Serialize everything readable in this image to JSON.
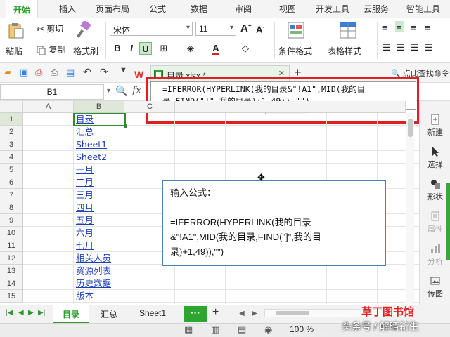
{
  "ribbon_tabs": [
    "开始",
    "插入",
    "页面布局",
    "公式",
    "数据",
    "审阅",
    "视图",
    "开发工具",
    "云服务",
    "智能工具"
  ],
  "ribbon": {
    "paste": "粘贴",
    "cut": "剪切",
    "copy": "复制",
    "format_painter": "格式刷",
    "font_name": "宋体",
    "font_size": "11",
    "bold": "B",
    "italic": "I",
    "underline": "U",
    "conditional_format": "条件格式",
    "table_style": "表格样式"
  },
  "document_tab": {
    "filename": "目录.xlsx *",
    "find_command": "点此查找命令"
  },
  "formula_bar": {
    "name_box": "B1",
    "fx": "fx",
    "formula_line1": "=IFERROR(HYPERLINK(我的目录&\"!A1\",MID(我的目",
    "formula_line2": "录,FIND(\"]\",我的目录)+1,49)),\"\")"
  },
  "columns": [
    "A",
    "B",
    "C"
  ],
  "rows": [
    "1",
    "2",
    "3",
    "4",
    "5",
    "6",
    "7",
    "8",
    "9",
    "10",
    "11",
    "12",
    "13",
    "14",
    "15"
  ],
  "column_b_links": [
    "目录",
    "汇总",
    "Sheet1",
    "Sheet2",
    "一月",
    "二月",
    "三月",
    "四月",
    "五月",
    "六月",
    "七月",
    "相关人员",
    "资源列表",
    "历史数据",
    "版本"
  ],
  "note": {
    "title": "输入公式：",
    "line1": "=IFERROR(HYPERLINK(我的目录",
    "line2": "&\"!A1\",MID(我的目录,FIND(\"]\",我的目",
    "line3": "录)+1,49)),\"\")"
  },
  "right_panel": [
    "新建",
    "选择",
    "形状",
    "属性",
    "分析",
    "传图"
  ],
  "sheet_tabs": [
    "目录",
    "汇总",
    "Sheet1"
  ],
  "more_tabs": "···",
  "add_tab": "+",
  "zoom": "100 %",
  "watermark": {
    "top": "草丁图书馆",
    "bottom": "头条号 / 解晴新生"
  },
  "colors": {
    "accent": "#2ea52e",
    "link": "#1a3fb8",
    "highlight_border": "#e02020"
  }
}
